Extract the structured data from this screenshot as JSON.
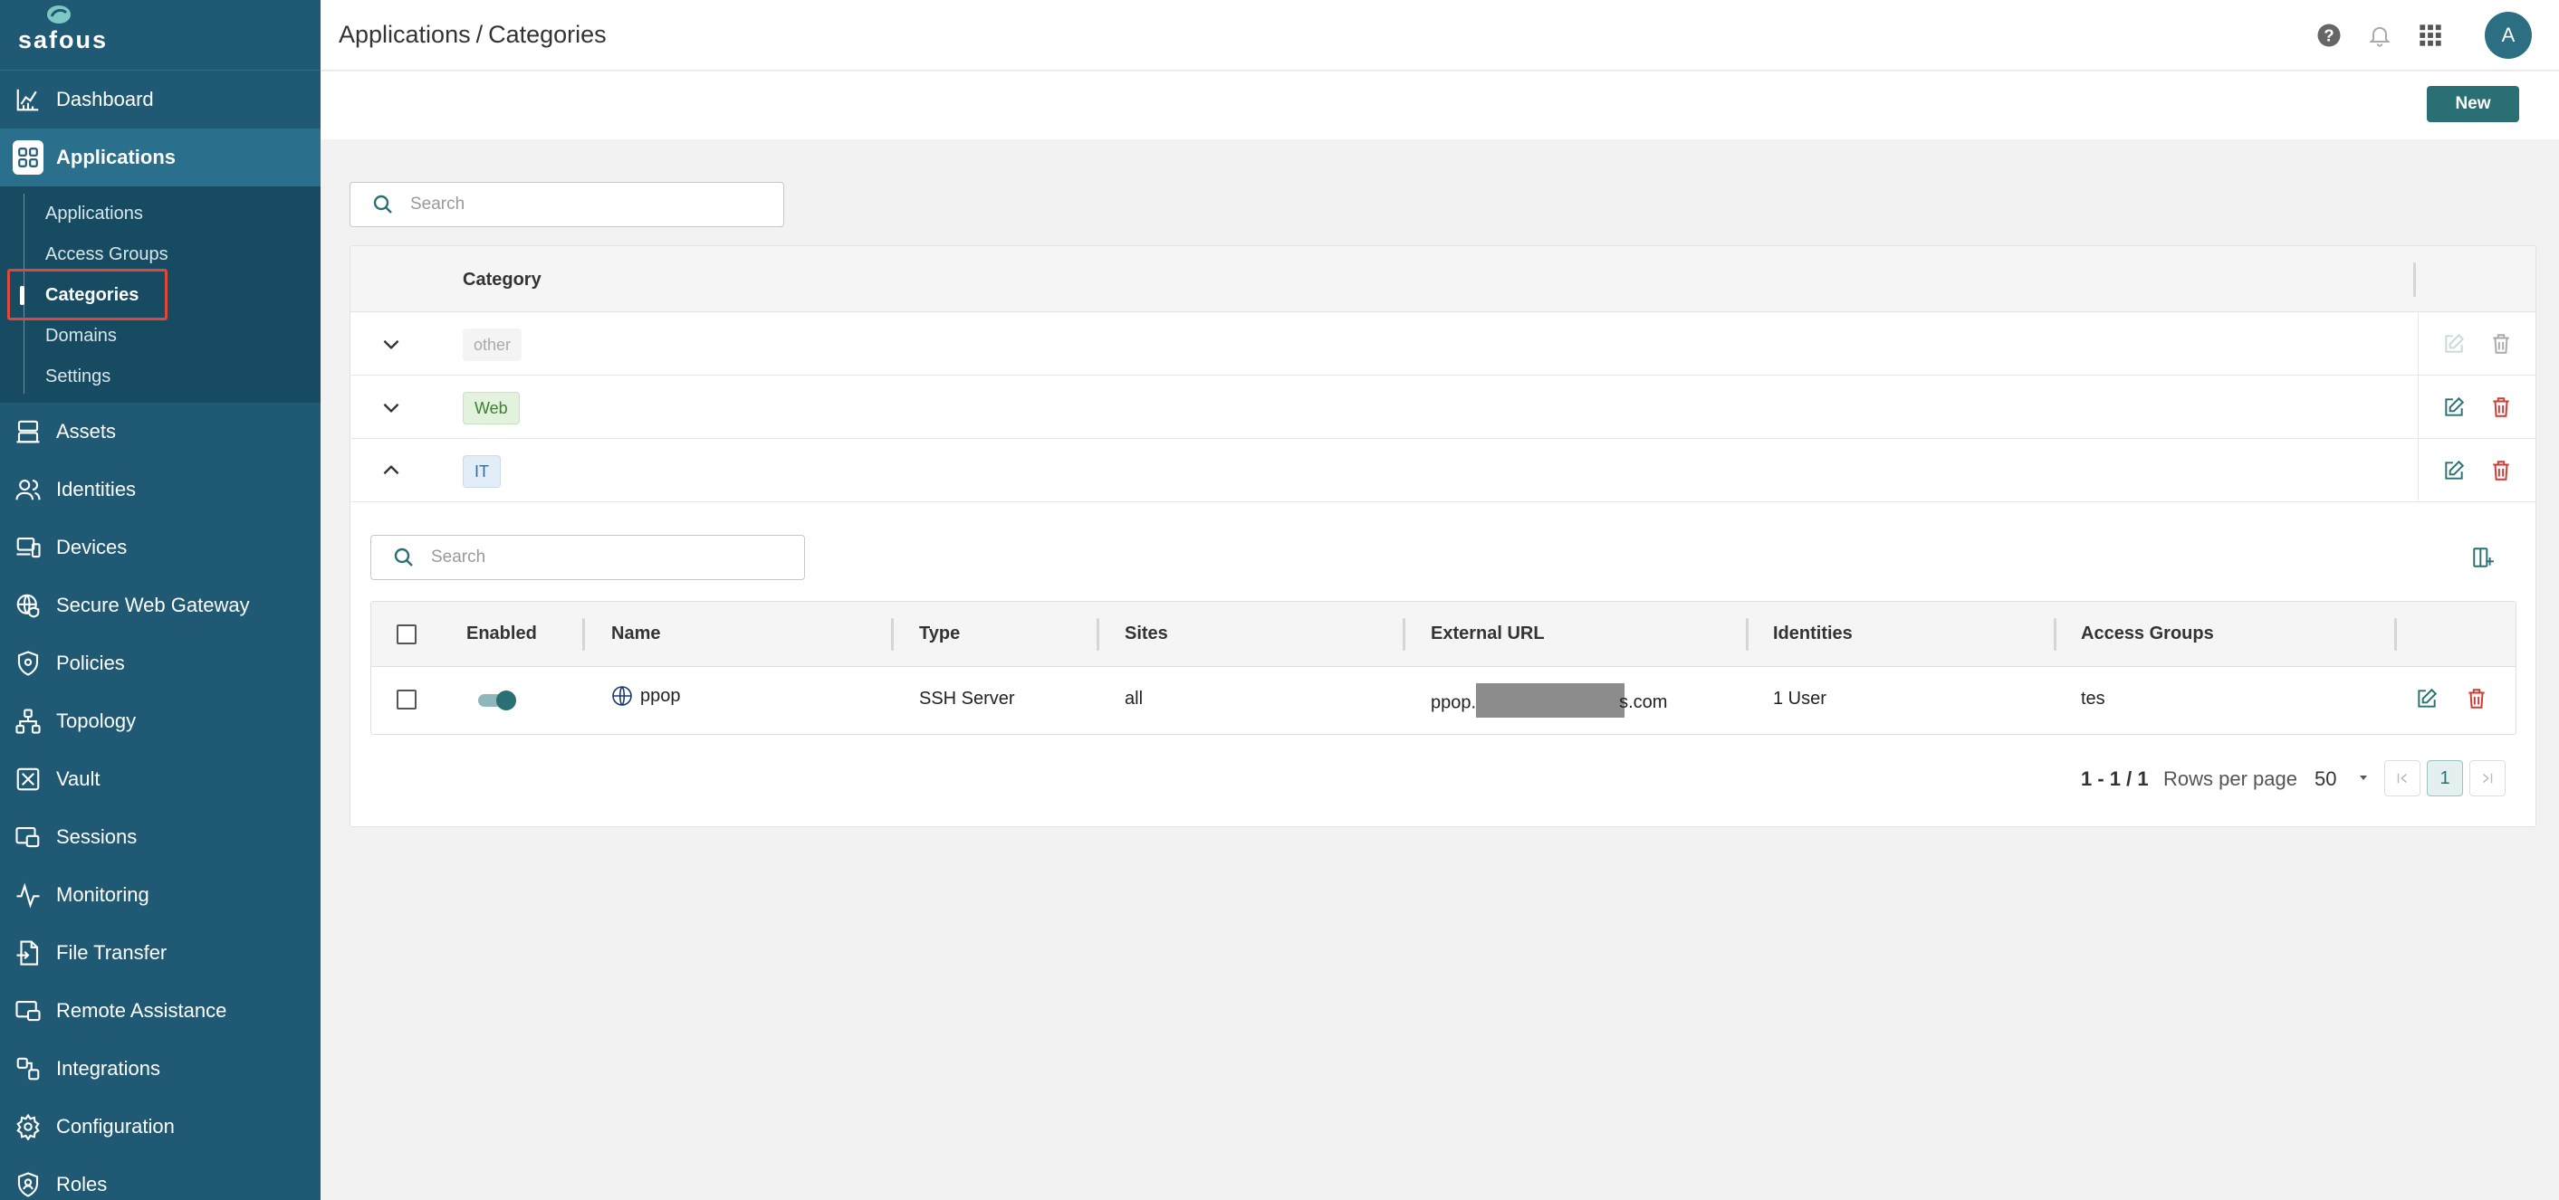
{
  "app": {
    "logo_text": "safous",
    "avatar_initial": "A"
  },
  "breadcrumb": {
    "parent": "Applications",
    "separator": "/",
    "current": "Categories"
  },
  "sidebar": {
    "items": [
      {
        "label": "Dashboard",
        "icon": "chart-line-icon"
      },
      {
        "label": "Applications",
        "icon": "grid-apps-icon",
        "expanded": true
      },
      {
        "label": "Assets",
        "icon": "server-icon"
      },
      {
        "label": "Identities",
        "icon": "users-icon"
      },
      {
        "label": "Devices",
        "icon": "devices-icon"
      },
      {
        "label": "Secure Web Gateway",
        "icon": "globe-shield-icon"
      },
      {
        "label": "Policies",
        "icon": "shield-icon"
      },
      {
        "label": "Topology",
        "icon": "topology-icon"
      },
      {
        "label": "Vault",
        "icon": "vault-icon"
      },
      {
        "label": "Sessions",
        "icon": "sessions-icon"
      },
      {
        "label": "Monitoring",
        "icon": "pulse-icon"
      },
      {
        "label": "File Transfer",
        "icon": "file-transfer-icon"
      },
      {
        "label": "Remote Assistance",
        "icon": "remote-icon"
      },
      {
        "label": "Integrations",
        "icon": "integrations-icon"
      },
      {
        "label": "Configuration",
        "icon": "gear-icon"
      },
      {
        "label": "Roles",
        "icon": "roles-icon"
      }
    ],
    "sub_items": [
      {
        "label": "Applications"
      },
      {
        "label": "Access Groups"
      },
      {
        "label": "Categories",
        "active": true
      },
      {
        "label": "Domains"
      },
      {
        "label": "Settings"
      }
    ]
  },
  "toolbar": {
    "new_label": "New"
  },
  "search": {
    "placeholder": "Search"
  },
  "categories": {
    "header": "Category",
    "rows": [
      {
        "name": "other",
        "expanded": false,
        "disabled": true
      },
      {
        "name": "Web",
        "expanded": false,
        "disabled": false
      },
      {
        "name": "IT",
        "expanded": true,
        "disabled": false
      }
    ]
  },
  "apps_table": {
    "search_placeholder": "Search",
    "columns": [
      "Enabled",
      "Name",
      "Type",
      "Sites",
      "External URL",
      "Identities",
      "Access Groups"
    ],
    "rows": [
      {
        "enabled": true,
        "name": "ppop",
        "type": "SSH Server",
        "sites": "all",
        "external_url_prefix": "ppop.",
        "external_url_suffix": "s.com",
        "identities": "1 User",
        "access_groups": "tes"
      }
    ]
  },
  "pagination": {
    "range": "1 - 1 / 1",
    "rows_per_page_label": "Rows per page",
    "rows_per_page": "50",
    "current_page": "1"
  },
  "colors": {
    "sidebar_bg": "#1f5973",
    "accent": "#2a6f73",
    "delete_red": "#d03a34",
    "highlight_box": "#e0463c"
  }
}
